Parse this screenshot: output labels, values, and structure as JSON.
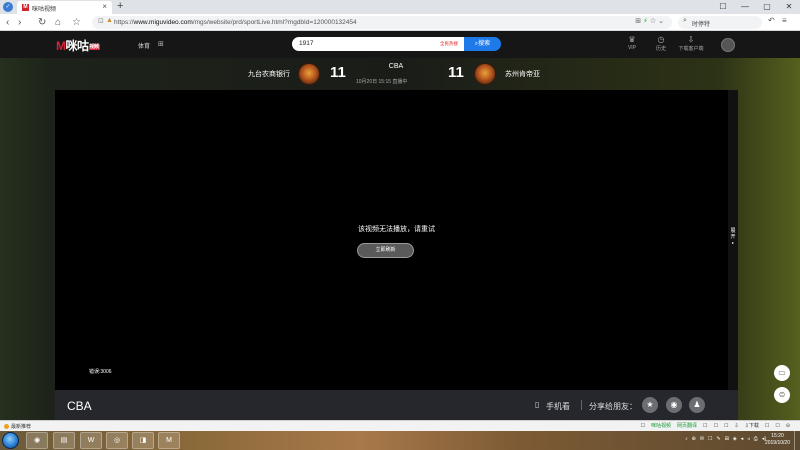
{
  "browser": {
    "tab_title": "咪咕视频",
    "tab_favicon": "M",
    "new_tab": "+",
    "close_tab": "×",
    "url_prefix": "https://",
    "url_domain": "www.miguvideo.com",
    "url_path": "/mgs/website/prd/sportLive.html?mgdbId=120000132454",
    "search_text": "时停特",
    "window_buttons": [
      "☐",
      "—",
      "▢",
      "✕"
    ]
  },
  "site": {
    "logo_text": "咪咕",
    "logo_tag": "视频",
    "nav_sports": "体育",
    "search_query": "1917",
    "search_hot": "全民热搜",
    "search_button": "搜索",
    "header_items": [
      {
        "icon": "vip-icon",
        "glyph": "♛",
        "label": "VIP"
      },
      {
        "icon": "history-icon",
        "glyph": "◷",
        "label": "历史"
      },
      {
        "icon": "download-icon",
        "glyph": "⇩",
        "label": "下载客户端"
      }
    ]
  },
  "match": {
    "home_team": "九台农商银行",
    "home_score": "11",
    "away_team": "苏州肯帝亚",
    "away_score": "11",
    "league": "CBA",
    "time": "10月20日 15:15",
    "status": "直播中"
  },
  "player": {
    "error_message": "该视频无法播放，请重试",
    "retry_button": "立即刷新",
    "error_code": "错误:3006",
    "side_tab": "展开"
  },
  "info_bar": {
    "title": "CBA",
    "phone_watch": "手机看",
    "share_label": "分享给朋友：",
    "share_icons": [
      "star-icon",
      "weibo-icon",
      "qq-icon"
    ]
  },
  "statusbar": {
    "left": "最新推荐",
    "right": [
      "☐",
      "咪咕视频",
      "网页翻译",
      "☐",
      "☐",
      "☐",
      "⇩",
      "⇩下载",
      "☐",
      "☐",
      "⊝"
    ]
  },
  "taskbar": {
    "apps": [
      "◉",
      "▤",
      "W",
      "◎",
      "◨",
      "M"
    ],
    "clock_time": "15:20",
    "clock_date": "2019/10/20",
    "tray": [
      "♪",
      "⊕",
      "✉",
      "☐",
      "✎",
      "⊞",
      "◈",
      "◂",
      "◃",
      "⎙",
      "◂)"
    ]
  }
}
